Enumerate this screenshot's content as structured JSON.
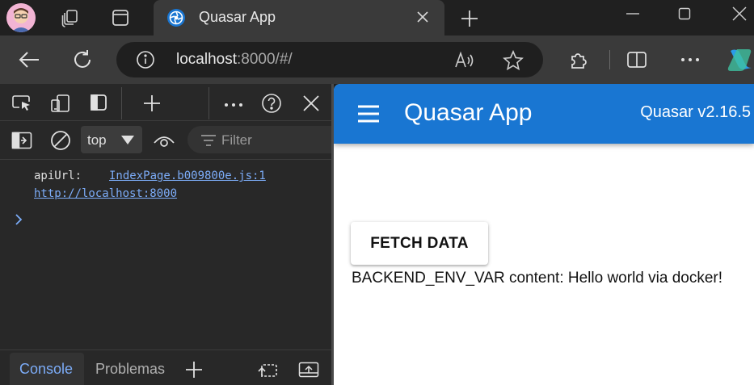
{
  "browser": {
    "tab": {
      "title": "Quasar App"
    },
    "address": {
      "host": "localhost",
      "rest": ":8000/#/"
    }
  },
  "devtools": {
    "context": "top",
    "filter_placeholder": "Filter",
    "console": {
      "log_key": "apiUrl:",
      "log_source": "IndexPage.b009800e.js:1",
      "log_value": "http://localhost:8000"
    },
    "bottom_tabs": [
      "Console",
      "Problemas"
    ]
  },
  "app": {
    "title": "Quasar App",
    "version": "Quasar v2.16.5",
    "fetch_button": "FETCH DATA",
    "result": "BACKEND_ENV_VAR content: Hello world via docker!"
  },
  "colors": {
    "primary": "#1976d2",
    "link": "#7cacf8"
  }
}
